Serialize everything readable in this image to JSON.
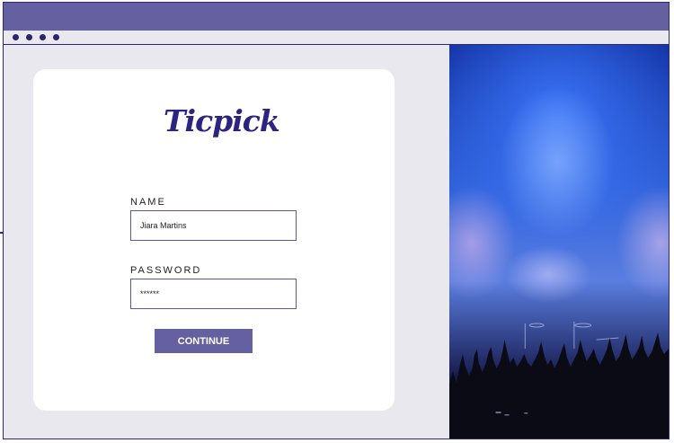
{
  "brand": {
    "name": "Ticpick"
  },
  "form": {
    "name_label": "NAME",
    "name_value": "Jiara Martins",
    "password_label": "PASSWORD",
    "password_value": "******",
    "continue_label": "CONTINUE"
  },
  "colors": {
    "titlebar": "#6561a0",
    "accent": "#6561a0",
    "logo": "#2b2480",
    "background": "#e9e8ef"
  }
}
